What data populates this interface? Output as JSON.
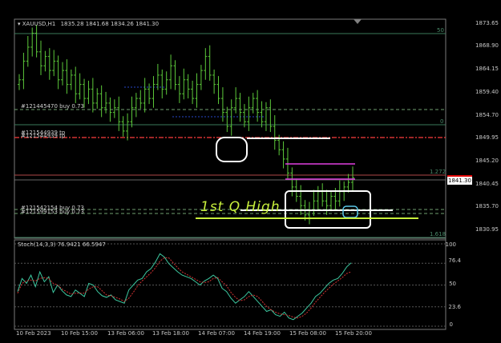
{
  "header": {
    "symbol": "XAUUSD,H1",
    "ohlc": "1835.28 1841.68 1834.26 1841.30"
  },
  "price_axis": {
    "labels": [
      "1873.65",
      "1868.90",
      "1864.15",
      "1859.40",
      "1854.70",
      "1849.95",
      "1845.20",
      "1840.45",
      "1835.70",
      "1830.95"
    ],
    "current_price": "1841.30"
  },
  "fib_levels": {
    "top": "50",
    "mid": "0",
    "upper": "1.272",
    "lower": "1.618"
  },
  "orders": {
    "buy_upper": "#121445470 buy 0.73",
    "tp_a": "#121544939 tp",
    "tp_b": "#121544939 tp",
    "buy_lower_a": "#121542154 buy 0.73",
    "buy_lower_b": "#121599153 buy 0.73"
  },
  "annotation": {
    "text": "1st Q High"
  },
  "stoch": {
    "label": "Stoch(14,3,3) 76.9421 66.5947",
    "levels": [
      "100",
      "76.4",
      "50",
      "23.6",
      "0"
    ]
  },
  "time_axis": {
    "labels": [
      "10 Feb 2023",
      "10 Feb 15:00",
      "13 Feb 06:00",
      "13 Feb 18:00",
      "14 Feb 07:00",
      "14 Feb 19:00",
      "15 Feb 08:00",
      "15 Feb 20:00"
    ]
  },
  "colors": {
    "candle": "#5cc83a",
    "fib": "#3a7a5a",
    "tp_line": "#d23232",
    "buy_line": "#6fa06f",
    "stoch_main": "#3cc8a0",
    "stoch_signal": "#d23232",
    "annotation": "#c8f03c",
    "magenta": "#e040e0"
  },
  "chart_data": {
    "type": "candlestick",
    "symbol": "XAUUSD",
    "timeframe": "H1",
    "ylim": [
      1828,
      1875
    ],
    "x_ticks": [
      "10 Feb 2023",
      "10 Feb 15:00",
      "13 Feb 06:00",
      "13 Feb 18:00",
      "14 Feb 07:00",
      "14 Feb 19:00",
      "15 Feb 08:00",
      "15 Feb 20:00"
    ],
    "close": [
      1862,
      1866,
      1869,
      1872,
      1868,
      1865,
      1867,
      1864,
      1866,
      1862,
      1864,
      1861,
      1863,
      1859,
      1861,
      1858,
      1860,
      1857,
      1859,
      1856,
      1857,
      1855,
      1856,
      1853,
      1851,
      1853,
      1856,
      1858,
      1857,
      1860,
      1858,
      1861,
      1863,
      1860,
      1862,
      1865,
      1861,
      1859,
      1862,
      1860,
      1858,
      1861,
      1864,
      1867,
      1863,
      1861,
      1858,
      1855,
      1852,
      1856,
      1858,
      1855,
      1853,
      1856,
      1858,
      1855,
      1853,
      1856,
      1852,
      1849,
      1847,
      1845,
      1842,
      1839,
      1837,
      1835,
      1833,
      1834,
      1836,
      1838,
      1836,
      1835,
      1837,
      1836,
      1838,
      1839,
      1840,
      1841
    ],
    "stoch": {
      "main": [
        42,
        58,
        52,
        62,
        48,
        66,
        54,
        60,
        41,
        50,
        43,
        38,
        36,
        44,
        40,
        36,
        52,
        50,
        42,
        37,
        35,
        38,
        32,
        30,
        28,
        44,
        50,
        56,
        58,
        66,
        70,
        78,
        88,
        84,
        76,
        71,
        66,
        62,
        60,
        58,
        54,
        50,
        55,
        58,
        62,
        58,
        46,
        42,
        34,
        28,
        32,
        36,
        42,
        36,
        30,
        24,
        18,
        20,
        14,
        12,
        17,
        10,
        8,
        12,
        16,
        22,
        28,
        36,
        40,
        46,
        52,
        56,
        58,
        64,
        72,
        77
      ],
      "signal": [
        40,
        52,
        55,
        56,
        55,
        58,
        59,
        58,
        52,
        50,
        45,
        42,
        39,
        40,
        40,
        40,
        45,
        48,
        48,
        43,
        38,
        37,
        35,
        33,
        30,
        34,
        41,
        49,
        55,
        60,
        65,
        71,
        79,
        83,
        83,
        77,
        71,
        66,
        63,
        60,
        57,
        54,
        53,
        54,
        58,
        59,
        54,
        49,
        41,
        35,
        31,
        32,
        36,
        38,
        36,
        30,
        24,
        20,
        17,
        15,
        14,
        13,
        11,
        10,
        12,
        16,
        22,
        29,
        35,
        41,
        46,
        51,
        55,
        59,
        64,
        66
      ]
    },
    "stoch_levels": [
      100,
      76.4,
      50,
      23.6,
      0
    ]
  }
}
